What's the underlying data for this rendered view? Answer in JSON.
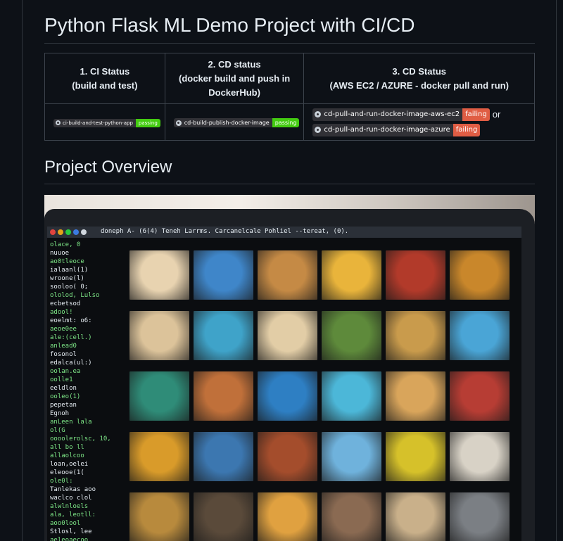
{
  "page": {
    "title": "Python Flask ML Demo Project with CI/CD",
    "section_title": "Project Overview"
  },
  "status_table": {
    "headers": [
      {
        "line1": "1. CI Status",
        "line2": "(build and test)"
      },
      {
        "line1": "2. CD status",
        "line2": "(docker build and push in",
        "line3": "DockerHub)"
      },
      {
        "line1": "3. CD Status",
        "line2": "(AWS EC2 / AZURE - docker pull and run)"
      }
    ],
    "badges": {
      "ci": {
        "label": "ci-build-and-test-python-app",
        "value": "passing",
        "color": "#4c1"
      },
      "cd_build": {
        "label": "cd-build-publish-docker-image",
        "value": "passing",
        "color": "#4c1"
      },
      "cd_aws": {
        "label": "cd-pull-and-run-docker-image-aws-ec2",
        "value": "failing",
        "color": "#e05d44"
      },
      "cd_azure": {
        "label": "cd-pull-and-run-docker-image-azure",
        "value": "failing",
        "color": "#e05d44"
      }
    },
    "or_text": "or"
  },
  "overview_image": {
    "topbar_text": "doneph A- (6(4) Teneh Larrms. Carcanelcale Pohliel --tereat, (0).",
    "code_lines": [
      "olace, 0",
      "nuuoe",
      "ao0tleoce",
      "ialaanl(1)",
      "wroone(l)",
      "sooloo( 0;",
      "ololod, Lulso",
      "ecbetsod",
      "adool!",
      "eoelmt: o6:",
      "aeoe0ee",
      "ale:(cell.)",
      "anlead0",
      "fosonol",
      "edalca(ul:)",
      "oolan.ea",
      "oolle1",
      "eeldlon",
      "ooleo(1)",
      "pepetan",
      "",
      "Egnoh",
      "anLeen lala",
      "ol(G",
      "oooolerolsc, 10,",
      "all bo ll",
      "allaolcoo",
      "loan,oelei",
      "eleooe(1(",
      "ole0l:",
      "",
      "Tanlekas aoo",
      "waclco clol",
      "alwlnloels",
      "ala, leotll:",
      "aoo0lool",
      "Stlosl, lee",
      "aeleoaecoo"
    ]
  }
}
